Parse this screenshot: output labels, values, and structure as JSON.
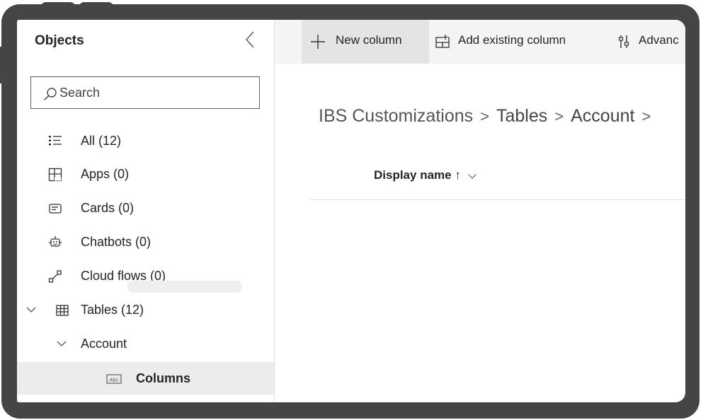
{
  "sidebar": {
    "title": "Objects",
    "search": {
      "placeholder": "Search",
      "value": ""
    },
    "items": [
      {
        "label": "All (12)",
        "icon": "list-icon"
      },
      {
        "label": "Apps (0)",
        "icon": "apps-grid-icon"
      },
      {
        "label": "Cards (0)",
        "icon": "card-icon"
      },
      {
        "label": "Chatbots (0)",
        "icon": "chatbot-icon"
      },
      {
        "label": "Cloud flows (0)",
        "icon": "cloud-flow-icon"
      },
      {
        "label": "Tables (12)",
        "icon": "table-icon",
        "expanded": true
      },
      {
        "label": "Account",
        "expanded": true
      },
      {
        "label": "Columns",
        "icon": "text-field-icon",
        "selected": true
      }
    ]
  },
  "commandbar": {
    "new_column": "New column",
    "add_existing_column": "Add existing column",
    "advanced": "Advanc"
  },
  "breadcrumb": {
    "items": [
      "IBS Customizations",
      "Tables",
      "Account"
    ]
  },
  "grid": {
    "column_header": "Display name ↑"
  },
  "colors": {
    "frame": "#454545",
    "selected_bg": "#ececec",
    "commandbar_bg": "#f4f4f4"
  }
}
